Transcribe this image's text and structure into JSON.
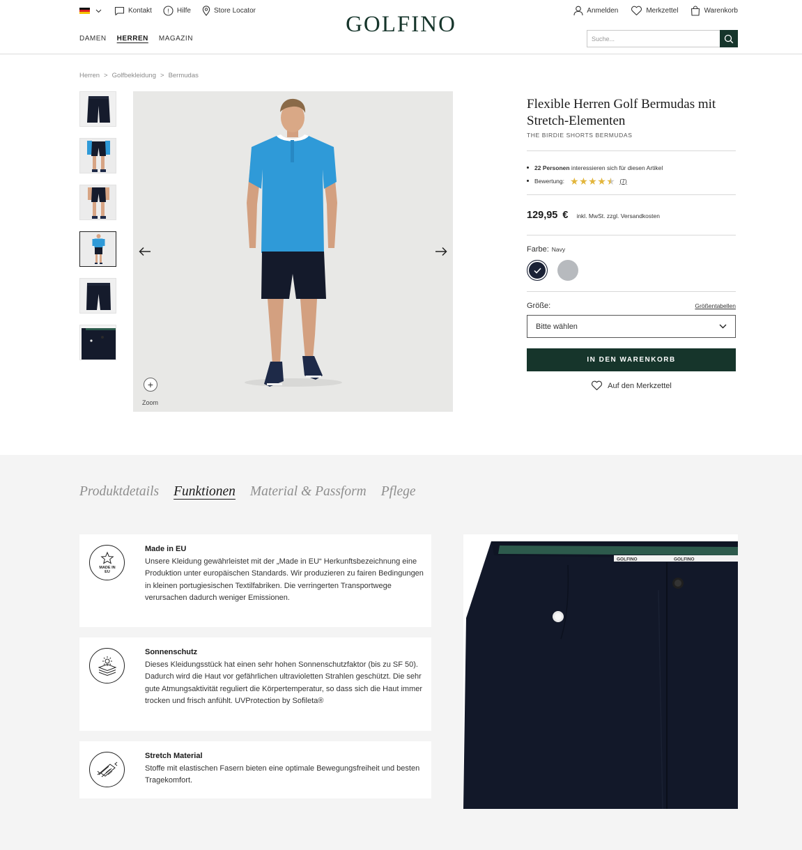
{
  "header": {
    "country_flag": "de",
    "util_left": [
      {
        "label": "Kontakt",
        "icon": "chat-bubble-icon"
      },
      {
        "label": "Hilfe",
        "icon": "help-circle-icon"
      },
      {
        "label": "Store Locator",
        "icon": "map-pin-icon"
      }
    ],
    "logo": "GOLFINO",
    "util_right": [
      {
        "label": "Anmelden",
        "icon": "user-icon"
      },
      {
        "label": "Merkzettel",
        "icon": "heart-icon"
      },
      {
        "label": "Warenkorb",
        "icon": "shopping-bag-icon"
      }
    ],
    "nav": [
      "DAMEN",
      "HERREN",
      "MAGAZIN"
    ],
    "nav_active": "HERREN",
    "search_placeholder": "Suche..."
  },
  "breadcrumb": [
    "Herren",
    "Golfbekleidung",
    "Bermudas"
  ],
  "gallery": {
    "thumbnail_count": 6,
    "active_thumbnail": 4,
    "zoom_label": "Zoom"
  },
  "product": {
    "title": "Flexible Herren Golf Bermudas mit Stretch-Elementen",
    "subtitle": "THE BIRDIE SHORTS BERMUDAS",
    "interest_count": "22 Personen",
    "interest_text": " interessieren sich für diesen Artikel",
    "rating_label": "Bewertung:",
    "rating_value": 4.5,
    "rating_count": "(7)",
    "price": "129,95",
    "currency": "€",
    "tax_note": "inkl. MwSt. zzgl. Versandkosten",
    "color_label": "Farbe:",
    "color_value": "Navy",
    "colors": [
      {
        "name": "Navy",
        "hex": "#1b2236",
        "selected": true
      },
      {
        "name": "Grey",
        "hex": "#b7babe",
        "selected": false
      }
    ],
    "size_label": "Größe:",
    "size_table_link": "Größentabellen",
    "size_select": "Bitte wählen",
    "add_to_cart": "IN DEN WARENKORB",
    "wishlist": "Auf den Merkzettel"
  },
  "details": {
    "tabs": [
      "Produktdetails",
      "Funktionen",
      "Material & Passform",
      "Pflege"
    ],
    "active_tab": "Funktionen",
    "features": [
      {
        "icon": "made-in-eu-star-icon",
        "badge_text": "MADE IN EU",
        "title": "Made in EU",
        "description": "Unsere Kleidung gewährleistet mit der „Made in EU“ Herkunftsbezeichnung eine Produktion unter europäischen Standards. Wir produzieren zu fairen Bedingungen in kleinen portugiesischen Textilfabriken. Die verringerten Transportwege verursachen dadurch weniger Emissionen."
      },
      {
        "icon": "sun-protection-icon",
        "title": "Sonnenschutz",
        "description": "Dieses Kleidungsstück hat einen sehr hohen Sonnenschutzfaktor (bis zu SF 50). Dadurch wird die Haut vor gefährlichen ultravioletten Strahlen geschützt. Die sehr gute Atmungsaktivität reguliert die Körpertemperatur, so dass sich die Haut immer trocken und frisch anfühlt. UVProtection by Sofileta®"
      },
      {
        "icon": "stretch-fabric-icon",
        "title": "Stretch Material",
        "description": "Stoffe mit elastischen Fasern bieten eine optimale Bewegungsfreiheit und besten Tragekomfort."
      }
    ],
    "waistband_label": "GOLFINO"
  },
  "colors": {
    "brand_green": "#16352b",
    "star_gold": "#e2b53b",
    "shirt_blue": "#2f9ad8",
    "shorts_navy": "#141a2b"
  }
}
